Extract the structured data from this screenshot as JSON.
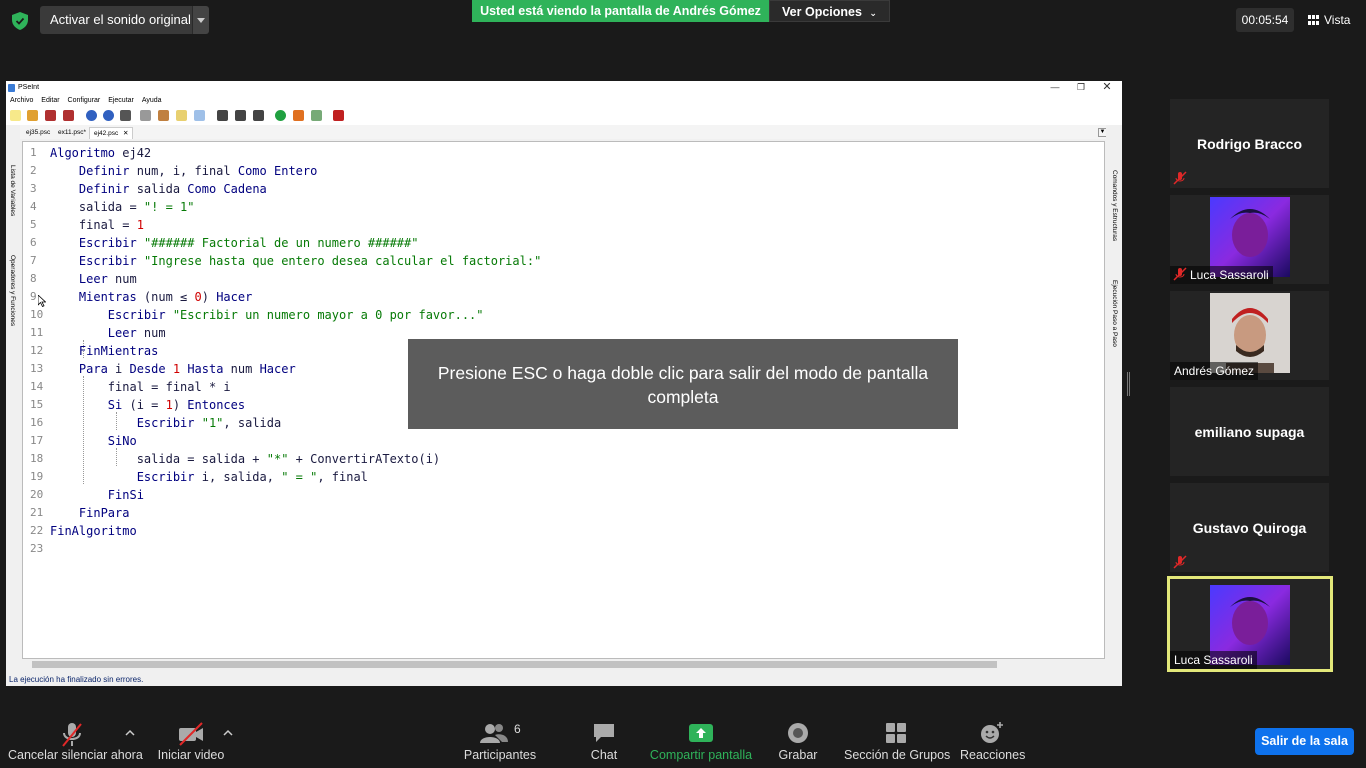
{
  "topbar": {
    "audio_button": "Activar el sonido original",
    "share_banner": "Usted está viendo la pantalla de Andrés Gómez",
    "view_options": "Ver Opciones",
    "timer": "00:05:54",
    "view_label": "Vista"
  },
  "pseint": {
    "title": "PSeInt",
    "menu": [
      "Archivo",
      "Editar",
      "Configurar",
      "Ejecutar",
      "Ayuda"
    ],
    "tabs": [
      "ej35.psc",
      "ex11.psc*",
      "ej42.psc"
    ],
    "left_rail": [
      "Lista de Variables",
      "Operadores y Funciones"
    ],
    "right_rail": [
      "Comandos y Estructuras",
      "Ejecución Paso a Paso"
    ],
    "line_numbers": [
      "1",
      "2",
      "3",
      "4",
      "5",
      "6",
      "7",
      "8",
      "9",
      "10",
      "11",
      "12",
      "13",
      "14",
      "15",
      "16",
      "17",
      "18",
      "19",
      "20",
      "21",
      "22",
      "23"
    ],
    "status": "La ejecución ha finalizado sin errores."
  },
  "code": [
    "Algoritmo ej42",
    "    Definir num, i, final Como Entero",
    "    Definir salida Como Cadena",
    "    salida = \"! = 1\"",
    "    final = 1",
    "    Escribir \"###### Factorial de un numero ######\"",
    "    Escribir \"Ingrese hasta que entero desea calcular el factorial:\"",
    "    Leer num",
    "    Mientras (num ≤ 0) Hacer",
    "        Escribir \"Escribir un numero mayor a 0 por favor...\"",
    "        Leer num",
    "    FinMientras",
    "    Para i Desde 1 Hasta num Hacer",
    "        final = final * i",
    "        Si (i = 1) Entonces",
    "            Escribir \"1\", salida",
    "        SiNo",
    "            salida = salida + \"*\" + ConvertirATexto(i)",
    "            Escribir i, salida, \" = \", final",
    "        FinSi",
    "    FinPara",
    "FinAlgoritmo",
    ""
  ],
  "overlay": {
    "message": "Presione ESC o haga doble clic para salir del modo de pantalla completa"
  },
  "participants": [
    {
      "name": "Rodrigo Bracco",
      "muted": true,
      "video": false
    },
    {
      "name": "Luca Sassaroli",
      "muted": true,
      "video": true
    },
    {
      "name": "Andrés Gómez",
      "muted": false,
      "video": true
    },
    {
      "name": "emiliano supaga",
      "muted": false,
      "video": false
    },
    {
      "name": "Gustavo Quiroga",
      "muted": true,
      "video": false
    },
    {
      "name": "Luca Sassaroli",
      "muted": false,
      "video": true,
      "active_speaker": true
    }
  ],
  "toolbar": {
    "mute_label": "Cancelar silenciar ahora",
    "video_label": "Iniciar video",
    "participants_label": "Participantes",
    "participants_count": "6",
    "chat_label": "Chat",
    "share_label": "Compartir pantalla",
    "record_label": "Grabar",
    "breakout_label": "Sección de Grupos",
    "reactions_label": "Reacciones",
    "leave_label": "Salir de la sala"
  },
  "colors": {
    "share_green": "#2fb35a",
    "leave_blue": "#0e72ed",
    "speaker_border": "#e3e87a",
    "keyword": "#00007f",
    "string": "#067a06",
    "number": "#d00000"
  }
}
